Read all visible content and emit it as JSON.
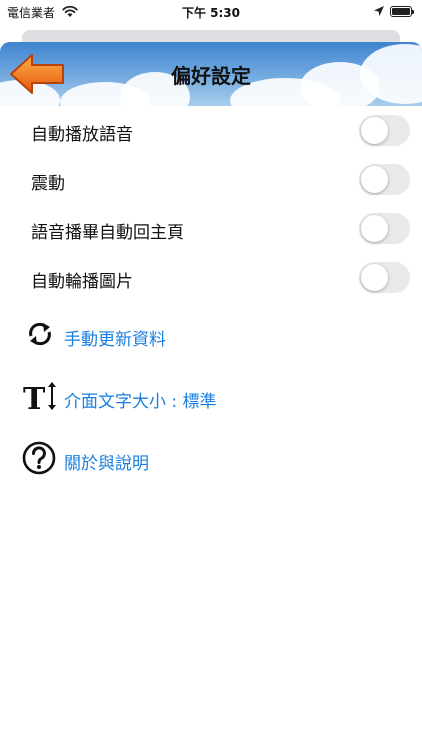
{
  "status_bar": {
    "carrier": "電信業者",
    "time": "下午 5:30"
  },
  "header": {
    "title": "偏好設定"
  },
  "settings": [
    {
      "label": "自動播放語音",
      "on": false
    },
    {
      "label": "震動",
      "on": false
    },
    {
      "label": "語音播畢自動回主頁",
      "on": false
    },
    {
      "label": "自動輪播圖片",
      "on": false
    }
  ],
  "links": [
    {
      "label": "手動更新資料",
      "icon": "refresh-icon"
    },
    {
      "label": "介面文字大小 : 標準",
      "icon": "text-size-icon"
    },
    {
      "label": "關於與說明",
      "icon": "help-icon"
    }
  ],
  "colors": {
    "link": "#1a7fe0",
    "toggle_off": "#e9e9ea",
    "back_arrow": "#f47a16"
  }
}
